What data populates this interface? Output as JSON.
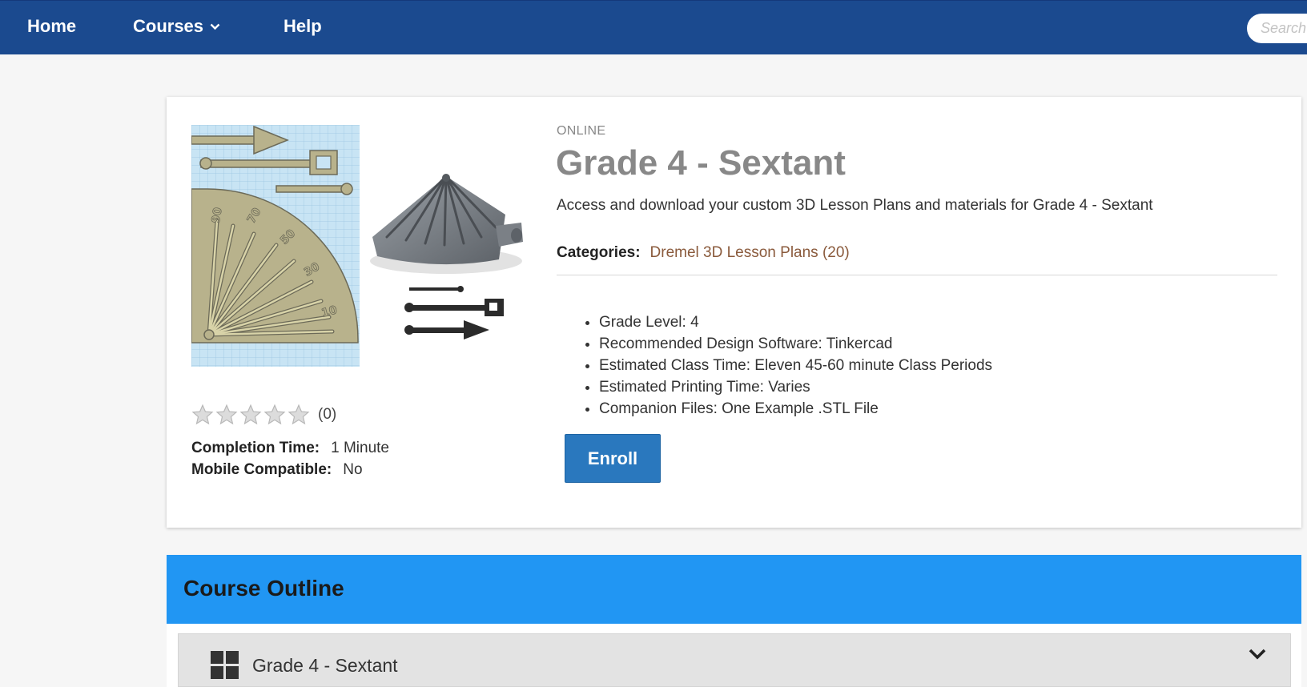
{
  "nav": {
    "home": "Home",
    "courses": "Courses",
    "help": "Help",
    "search_placeholder": "Search"
  },
  "course": {
    "type": "ONLINE",
    "title": "Grade 4 - Sextant",
    "description": "Access and download your custom 3D Lesson Plans and materials for Grade 4 - Sextant",
    "categories_label": "Categories:",
    "category_link": "Dremel 3D Lesson Plans (20)",
    "details": [
      "Grade Level: 4",
      "Recommended Design Software: Tinkercad",
      "Estimated Class Time: Eleven 45-60 minute Class Periods",
      "Estimated Printing Time: Varies",
      "Companion Files: One Example .STL File"
    ],
    "enroll_label": "Enroll"
  },
  "rating": {
    "stars_filled": 0,
    "stars_total": 5,
    "count_text": "(0)"
  },
  "meta": {
    "completion_label": "Completion Time:",
    "completion_value": "1 Minute",
    "mobile_label": "Mobile Compatible:",
    "mobile_value": "No"
  },
  "outline": {
    "title": "Course Outline",
    "items": [
      {
        "label": "Grade 4 - Sextant"
      }
    ]
  },
  "colors": {
    "nav_bg": "#1b4a8f",
    "outline_header_bg": "#2196f3",
    "enroll_bg": "#2a78be",
    "category_link": "#8a5a3c",
    "title_gray": "#888888"
  }
}
